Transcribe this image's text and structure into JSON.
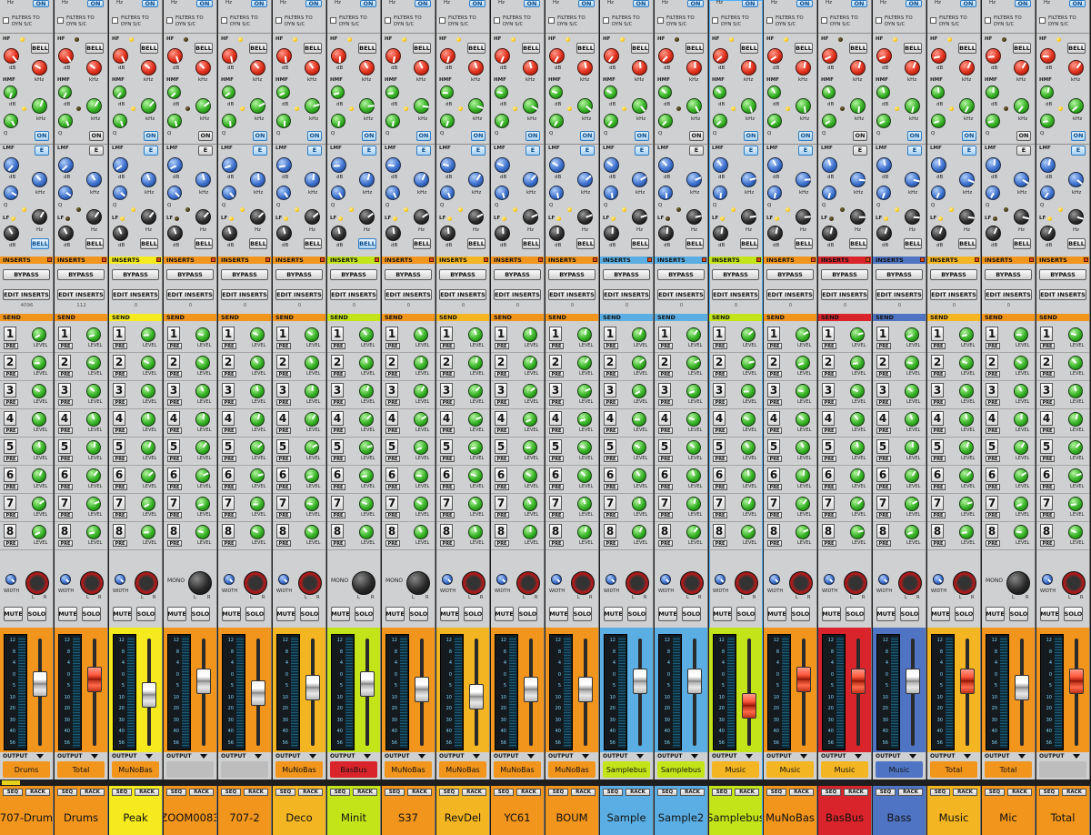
{
  "labels": {
    "filters_to": "FILTERS TO",
    "dyn_sc": "DYN S/C",
    "hz": "Hz",
    "on": "ON",
    "hf": "HF",
    "hmf": "HMF",
    "lmf": "LMF",
    "lf": "LF",
    "db": "dB",
    "khz": "kHz",
    "q": "Q",
    "bell": "BELL",
    "e": "E",
    "inserts": "INSERTS",
    "bypass": "BYPASS",
    "edit_inserts": "EDIT INSERTS",
    "send": "SEND",
    "pre": "PRE",
    "level": "LEVEL",
    "width": "WIDTH",
    "mono": "MONO",
    "l": "L",
    "r": "R",
    "mute": "MUTE",
    "solo": "SOLO",
    "output": "OUTPUT",
    "seq": "SEQ",
    "rack": "RACK",
    "send_numbers": [
      "1",
      "2",
      "3",
      "4",
      "5",
      "6",
      "7",
      "8"
    ],
    "meter_ticks": [
      "12",
      "8",
      "4",
      "0",
      "5",
      "10",
      "20",
      "30",
      "40",
      "56"
    ]
  },
  "colors": {
    "orange": "#f1951c",
    "yellow": "#f4ea1e",
    "lime": "#c4e41a",
    "red": "#d8242a",
    "blue": "#5aaee4",
    "darkblue": "#4f74c4",
    "gold": "#f3b521",
    "grey": "#bdbdbd"
  },
  "channels": [
    {
      "name": "707-Drum",
      "output": "Drums",
      "color": "#f1951c",
      "outcolor": "#f1951c",
      "send_color": "#f1951c",
      "inserts_color": "#f1951c",
      "insert_value": "4096",
      "stereo": true,
      "fader": 0.62,
      "red_fader": false,
      "eq_on": true
    },
    {
      "name": "Drums",
      "output": "Total",
      "color": "#f1951c",
      "outcolor": "#f1951c",
      "send_color": "#f1951c",
      "inserts_color": "#f1951c",
      "insert_value": "112",
      "stereo": true,
      "fader": 0.68,
      "red_fader": true,
      "eq_on": false
    },
    {
      "name": "Peak",
      "output": "MuNoBas",
      "color": "#f4ea1e",
      "outcolor": "#f1951c",
      "send_color": "#f4ea1e",
      "inserts_color": "#f4ea1e",
      "insert_value": "0",
      "stereo": true,
      "fader": 0.5,
      "red_fader": false,
      "eq_on": true
    },
    {
      "name": "ZOOM0083",
      "output": "",
      "color": "#f1951c",
      "outcolor": "#bdbdbd",
      "send_color": "#f1951c",
      "inserts_color": "#f1951c",
      "insert_value": "0",
      "stereo": false,
      "fader": 0.66,
      "red_fader": false,
      "eq_on": false
    },
    {
      "name": "707-2",
      "output": "",
      "color": "#f1951c",
      "outcolor": "#bdbdbd",
      "send_color": "#f1951c",
      "inserts_color": "#f1951c",
      "insert_value": "0",
      "stereo": true,
      "fader": 0.52,
      "red_fader": false,
      "eq_on": true
    },
    {
      "name": "Deco",
      "output": "MuNoBas",
      "color": "#f3b521",
      "outcolor": "#f1951c",
      "send_color": "#f1951c",
      "inserts_color": "#f1951c",
      "insert_value": "0",
      "stereo": true,
      "fader": 0.58,
      "red_fader": false,
      "eq_on": true
    },
    {
      "name": "Minit",
      "output": "BasBus",
      "color": "#c4e41a",
      "outcolor": "#d8242a",
      "send_color": "#c4e41a",
      "inserts_color": "#c4e41a",
      "insert_value": "0",
      "stereo": false,
      "fader": 0.62,
      "red_fader": false,
      "eq_on": true
    },
    {
      "name": "S37",
      "output": "MuNoBas",
      "color": "#f1951c",
      "outcolor": "#f1951c",
      "send_color": "#f1951c",
      "inserts_color": "#f1951c",
      "insert_value": "0",
      "stereo": false,
      "fader": 0.56,
      "red_fader": false,
      "eq_on": true
    },
    {
      "name": "RevDel",
      "output": "MuNoBas",
      "color": "#f3b521",
      "outcolor": "#f1951c",
      "send_color": "#f3b521",
      "inserts_color": "#f3b521",
      "insert_value": "0",
      "stereo": true,
      "fader": 0.48,
      "red_fader": false,
      "eq_on": true
    },
    {
      "name": "YC61",
      "output": "MuNoBas",
      "color": "#f1951c",
      "outcolor": "#f1951c",
      "send_color": "#f1951c",
      "inserts_color": "#f1951c",
      "insert_value": "0",
      "stereo": true,
      "fader": 0.56,
      "red_fader": false,
      "eq_on": true
    },
    {
      "name": "BOUM",
      "output": "MuNoBas",
      "color": "#f1951c",
      "outcolor": "#f1951c",
      "send_color": "#f1951c",
      "inserts_color": "#f1951c",
      "insert_value": "0",
      "stereo": true,
      "fader": 0.56,
      "red_fader": false,
      "eq_on": true
    },
    {
      "name": "Sample",
      "output": "Samplebus",
      "color": "#5aaee4",
      "outcolor": "#c4e41a",
      "send_color": "#5aaee4",
      "inserts_color": "#5aaee4",
      "insert_value": "0",
      "stereo": true,
      "fader": 0.66,
      "red_fader": false,
      "eq_on": true
    },
    {
      "name": "Sample2",
      "output": "Samplebus",
      "color": "#5aaee4",
      "outcolor": "#c4e41a",
      "send_color": "#5aaee4",
      "inserts_color": "#5aaee4",
      "insert_value": "0",
      "stereo": true,
      "fader": 0.66,
      "red_fader": false,
      "eq_on": false
    },
    {
      "name": "Samplebus",
      "output": "Music",
      "color": "#c4e41a",
      "outcolor": "#f3b521",
      "send_color": "#c4e41a",
      "inserts_color": "#c4e41a",
      "insert_value": "0",
      "stereo": true,
      "fader": 0.38,
      "red_fader": true,
      "eq_on": true,
      "highlight": true
    },
    {
      "name": "MuNoBas",
      "output": "Music",
      "color": "#f1951c",
      "outcolor": "#f3b521",
      "send_color": "#f1951c",
      "inserts_color": "#f1951c",
      "insert_value": "0",
      "stereo": true,
      "fader": 0.68,
      "red_fader": true,
      "eq_on": true
    },
    {
      "name": "BasBus",
      "output": "Music",
      "color": "#d8242a",
      "outcolor": "#f3b521",
      "send_color": "#d8242a",
      "inserts_color": "#d8242a",
      "insert_value": "0",
      "stereo": true,
      "fader": 0.66,
      "red_fader": true,
      "eq_on": false
    },
    {
      "name": "Bass",
      "output": "Music",
      "color": "#4f74c4",
      "outcolor": "#4f74c4",
      "send_color": "#4f74c4",
      "inserts_color": "#4f74c4",
      "insert_value": "0",
      "stereo": true,
      "fader": 0.66,
      "red_fader": false,
      "eq_on": true
    },
    {
      "name": "Music",
      "output": "Total",
      "color": "#f3b521",
      "outcolor": "#f1951c",
      "send_color": "#f3b521",
      "inserts_color": "#f3b521",
      "insert_value": "0",
      "stereo": true,
      "fader": 0.66,
      "red_fader": true,
      "eq_on": true
    },
    {
      "name": "Mic",
      "output": "Total",
      "color": "#f1951c",
      "outcolor": "#f1951c",
      "send_color": "#f1951c",
      "inserts_color": "#f1951c",
      "insert_value": "0",
      "stereo": false,
      "fader": 0.58,
      "red_fader": false,
      "eq_on": false
    },
    {
      "name": "Total",
      "output": "",
      "color": "#f1951c",
      "outcolor": "#bdbdbd",
      "send_color": "#f1951c",
      "inserts_color": "#f1951c",
      "insert_value": "",
      "stereo": true,
      "fader": 0.66,
      "red_fader": true,
      "eq_on": true
    }
  ]
}
